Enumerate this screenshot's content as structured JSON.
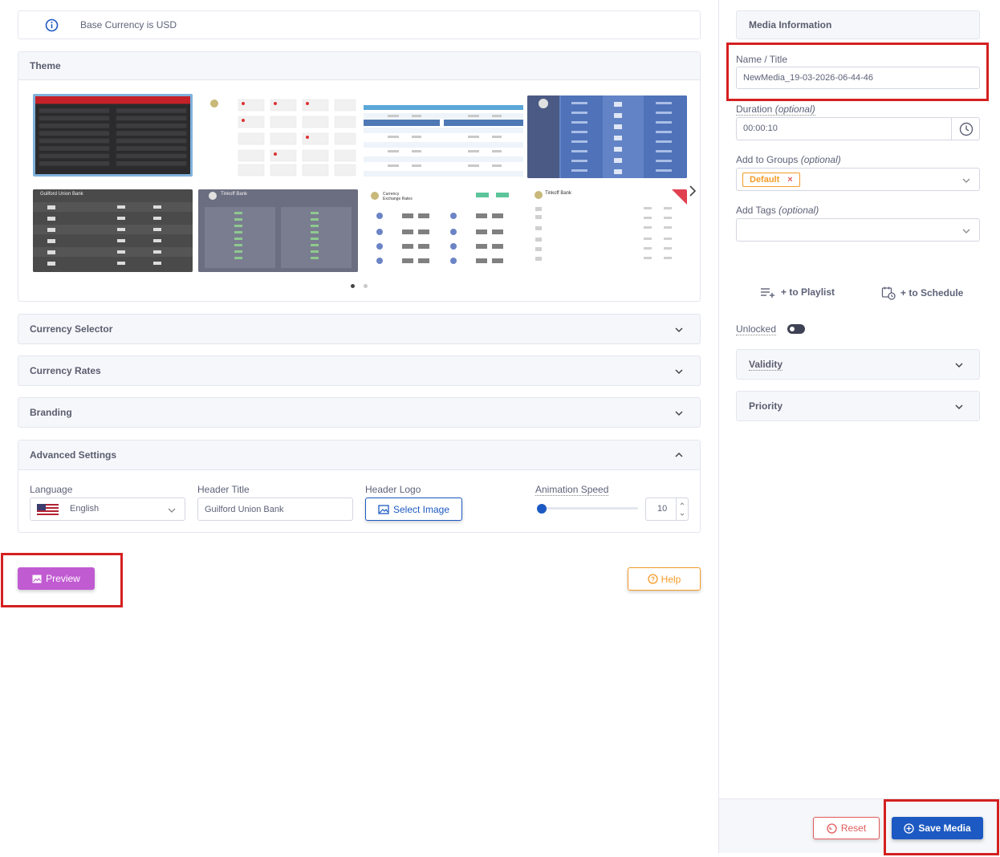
{
  "info": {
    "text": "Base Currency is USD",
    "icon": "info-icon"
  },
  "theme": {
    "title": "Theme",
    "thumbnails": [
      {
        "name": "theme-dark-red"
      },
      {
        "name": "theme-white-grid"
      },
      {
        "name": "theme-blue-table"
      },
      {
        "name": "theme-blue-columns"
      },
      {
        "name": "theme-gray-list",
        "caption": "Guilford Union Bank"
      },
      {
        "name": "theme-slate-table",
        "caption": "Tinkoff Bank"
      },
      {
        "name": "theme-light-exchange",
        "caption": "Currency Exchange Rates"
      },
      {
        "name": "theme-white-list",
        "caption": "Tinkoff Bank"
      }
    ],
    "pager_count": 2
  },
  "sections": {
    "currency_selector": "Currency Selector",
    "currency_rates": "Currency Rates",
    "branding": "Branding",
    "advanced": "Advanced Settings"
  },
  "advanced": {
    "language_label": "Language",
    "language_value": "English",
    "header_title_label": "Header Title",
    "header_title_value": "Guilford Union Bank",
    "header_logo_label": "Header Logo",
    "select_image": "Select Image",
    "animation_speed_label": "Animation Speed",
    "animation_speed_value": "10"
  },
  "buttons": {
    "preview": "Preview",
    "help": "Help",
    "reset": "Reset",
    "save": "Save Media"
  },
  "media": {
    "title": "Media Information",
    "name_label": "Name / Title",
    "name_value": "NewMedia_19-03-2026-06-44-46",
    "duration_label": "Duration",
    "duration_optional": "(optional)",
    "duration_value": "00:00:10",
    "groups_label": "Add to Groups",
    "groups_optional": "(optional)",
    "group_tag": "Default",
    "tags_label": "Add Tags",
    "tags_optional": "(optional)",
    "to_playlist": "+ to Playlist",
    "to_schedule": "+ to Schedule",
    "unlocked_label": "Unlocked",
    "validity": "Validity",
    "priority": "Priority"
  },
  "colors": {
    "accent_blue": "#1d59c2",
    "preview_purple": "#c15bd2",
    "help_orange": "#f49b28",
    "reset_red": "#e25b5b",
    "highlight_red": "#d42020",
    "tag_orange": "#f49b28"
  }
}
